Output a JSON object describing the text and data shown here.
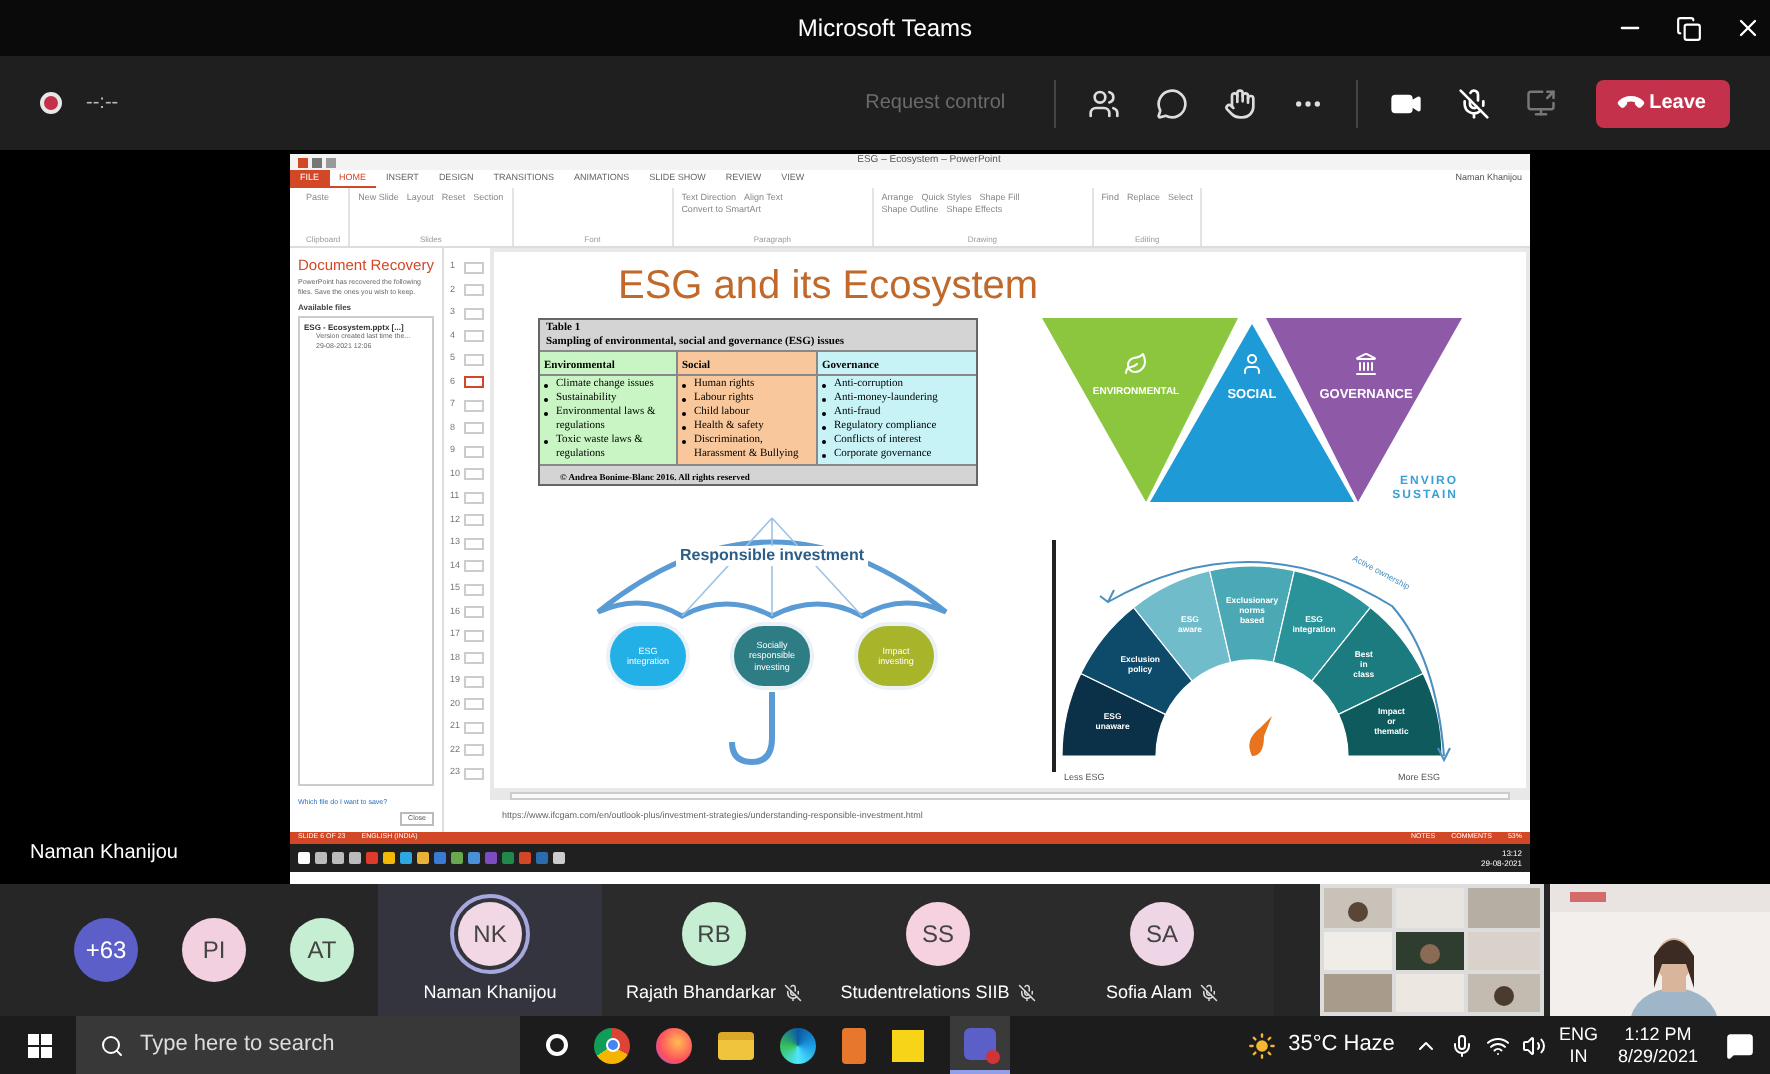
{
  "window": {
    "title": "Microsoft Teams"
  },
  "meeting_bar": {
    "recording": true,
    "timer": "--:--",
    "request_control": "Request control",
    "leave": "Leave"
  },
  "presentation": {
    "app_title": "ESG – Ecosystem – PowerPoint",
    "user": "Naman Khanijou",
    "ribbon_tabs": [
      {
        "label": "FILE",
        "selected": false
      },
      {
        "label": "HOME",
        "selected": true
      },
      {
        "label": "INSERT",
        "selected": false
      },
      {
        "label": "DESIGN",
        "selected": false
      },
      {
        "label": "TRANSITIONS",
        "selected": false
      },
      {
        "label": "ANIMATIONS",
        "selected": false
      },
      {
        "label": "SLIDE SHOW",
        "selected": false
      },
      {
        "label": "REVIEW",
        "selected": false
      },
      {
        "label": "VIEW",
        "selected": false
      }
    ],
    "ribbon_groups": [
      {
        "label": "Clipboard",
        "commands": [
          "Paste"
        ]
      },
      {
        "label": "Slides",
        "commands": [
          "New Slide",
          "Layout",
          "Reset",
          "Section"
        ]
      },
      {
        "label": "Font"
      },
      {
        "label": "Paragraph",
        "commands": [
          "Text Direction",
          "Align Text",
          "Convert to SmartArt"
        ]
      },
      {
        "label": "Drawing",
        "commands": [
          "Arrange",
          "Quick Styles",
          "Shape Fill",
          "Shape Outline",
          "Shape Effects"
        ]
      },
      {
        "label": "Editing",
        "commands": [
          "Find",
          "Replace",
          "Select"
        ]
      }
    ],
    "recovery": {
      "title": "Document Recovery",
      "message": "PowerPoint has recovered the following files. Save the ones you wish to keep.",
      "heading": "Available files",
      "file": "ESG - Ecosystem.pptx [...]",
      "file_note": "Version created last time the...",
      "file_date": "29-08-2021 12:06",
      "footer": "Which file do I want to save?",
      "close": "Close"
    },
    "thumbnails": [
      {
        "number": "1",
        "selected": false
      },
      {
        "number": "2",
        "selected": false
      },
      {
        "number": "3",
        "selected": false
      },
      {
        "number": "4",
        "selected": false
      },
      {
        "number": "5",
        "selected": false
      },
      {
        "number": "6",
        "selected": true
      },
      {
        "number": "7",
        "selected": false
      },
      {
        "number": "8",
        "selected": false
      },
      {
        "number": "9",
        "selected": false
      },
      {
        "number": "10",
        "selected": false
      },
      {
        "number": "11",
        "selected": false
      },
      {
        "number": "12",
        "selected": false
      },
      {
        "number": "13",
        "selected": false
      },
      {
        "number": "14",
        "selected": false
      },
      {
        "number": "15",
        "selected": false
      },
      {
        "number": "16",
        "selected": false
      },
      {
        "number": "17",
        "selected": false
      },
      {
        "number": "18",
        "selected": false
      },
      {
        "number": "19",
        "selected": false
      },
      {
        "number": "20",
        "selected": false
      },
      {
        "number": "21",
        "selected": false
      },
      {
        "number": "22",
        "selected": false
      },
      {
        "number": "23",
        "selected": false
      }
    ],
    "slide": {
      "title": "ESG and its Ecosystem",
      "table": {
        "label": "Table 1",
        "caption": "Sampling of environmental, social and governance (ESG) issues",
        "footer": "© Andrea Bonime-Blanc 2016. All rights reserved",
        "columns": [
          {
            "heading": "Environmental",
            "color": "#c9f5c4",
            "items": [
              "Climate change issues",
              "Sustainability",
              "Environmental laws & regulations",
              "Toxic waste laws & regulations"
            ]
          },
          {
            "heading": "Social",
            "color": "#f8c89c",
            "items": [
              "Human rights",
              "Labour rights",
              "Child labour",
              "Health & safety",
              "Discrimination, Harassment & Bullying"
            ]
          },
          {
            "heading": "Governance",
            "color": "#c8f3f6",
            "items": [
              "Anti-corruption",
              "Anti-money-laundering",
              "Anti-fraud",
              "Regulatory compliance",
              "Conflicts of interest",
              "Corporate governance"
            ]
          }
        ]
      },
      "pillars": [
        {
          "label": "ENVIRONMENTAL",
          "color": "#8cc63f"
        },
        {
          "label": "SOCIAL",
          "color": "#1e9ad6"
        },
        {
          "label": "GOVERNANCE",
          "color": "#8e5aa8"
        }
      ],
      "brand": [
        "ENVIRO",
        "SUSTAIN"
      ],
      "umbrella": {
        "title": "Responsible investment",
        "circles": [
          {
            "label": "ESG integration",
            "color": "#22b0e6"
          },
          {
            "label": "Socially responsible investing",
            "color": "#2e7d85"
          },
          {
            "label": "Impact investing",
            "color": "#a8b42a"
          }
        ]
      },
      "gauge": {
        "arrow_label": "Active ownership",
        "left": "Less ESG",
        "right": "More ESG",
        "segments": [
          {
            "label": "ESG unaware",
            "color": "#0b3148"
          },
          {
            "label": "Exclusion policy",
            "color": "#0e4a6a"
          },
          {
            "label": "ESG aware",
            "color": "#70bccb"
          },
          {
            "label": "Exclusionary norms based",
            "color": "#4aa9b4"
          },
          {
            "label": "ESG integration",
            "color": "#2a9299"
          },
          {
            "label": "Best in class",
            "color": "#1b7b7f"
          },
          {
            "label": "Impact or thematic",
            "color": "#0e5a5c"
          }
        ]
      }
    },
    "source_url": "https://www.ifcgam.com/en/outlook-plus/investment-strategies/understanding-responsible-investment.html",
    "status": {
      "slide": "SLIDE 6 OF 23",
      "language": "ENGLISH (INDIA)",
      "notes": "NOTES",
      "comments": "COMMENTS",
      "zoom": "53%"
    },
    "inner_clock": {
      "time": "13:12",
      "date": "29-08-2021"
    }
  },
  "presenter_label": "Naman Khanijou",
  "participants": [
    {
      "kind": "overflow",
      "initials": "+63",
      "color": "#5b5fc7"
    },
    {
      "kind": "avatar",
      "initials": "PI",
      "color": "#f3d0e0"
    },
    {
      "kind": "avatar",
      "initials": "AT",
      "color": "#c6eed3"
    },
    {
      "kind": "tile",
      "initials": "NK",
      "name": "Naman Khanijou",
      "color": "#f2d7e4",
      "speaking": true,
      "muted": false
    },
    {
      "kind": "tile",
      "initials": "RB",
      "name": "Rajath Bhandarkar",
      "color": "#c6eed3",
      "speaking": false,
      "muted": true
    },
    {
      "kind": "tile",
      "initials": "SS",
      "name": "Studentrelations SIIB",
      "color": "#f6d2e1",
      "speaking": false,
      "muted": true
    },
    {
      "kind": "tile",
      "initials": "SA",
      "name": "Sofia Alam",
      "color": "#efd6e7",
      "speaking": false,
      "muted": true
    }
  ],
  "taskbar": {
    "search_placeholder": "Type here to search",
    "weather": "35°C Haze",
    "language": "ENG",
    "region": "IN",
    "time": "1:12 PM",
    "date": "8/29/2021"
  }
}
